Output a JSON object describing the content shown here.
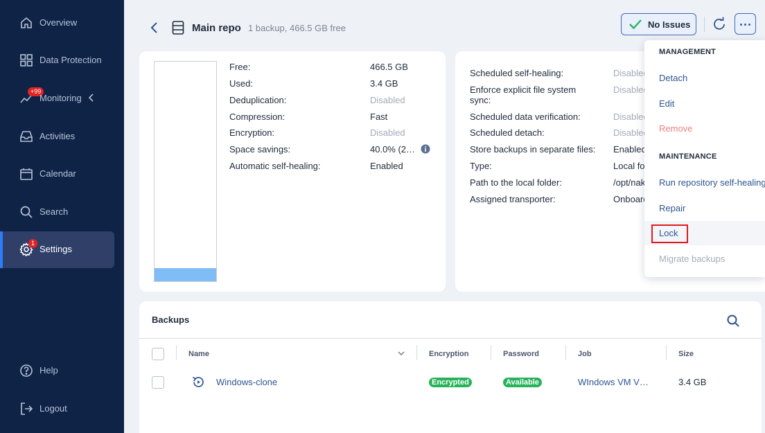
{
  "sidebar": {
    "items": [
      {
        "label": "Overview",
        "icon": "home-icon"
      },
      {
        "label": "Data Protection",
        "icon": "grid-icon"
      },
      {
        "label": "Monitoring",
        "icon": "chart-icon",
        "badge": "+99"
      },
      {
        "label": "Activities",
        "icon": "inbox-icon"
      },
      {
        "label": "Calendar",
        "icon": "calendar-icon"
      },
      {
        "label": "Search",
        "icon": "search-icon"
      },
      {
        "label": "Settings",
        "icon": "gear-icon",
        "badge": "1",
        "active": true
      }
    ],
    "bottom": [
      {
        "label": "Help",
        "icon": "help-icon"
      },
      {
        "label": "Logout",
        "icon": "logout-icon"
      }
    ]
  },
  "header": {
    "title": "Main repo",
    "subtitle": "1 backup, 466.5 GB free",
    "status_label": "No Issues"
  },
  "usage": {
    "used_fraction": 0.0073
  },
  "details_left": [
    {
      "label": "Free:",
      "value": "466.5 GB"
    },
    {
      "label": "Used:",
      "value": "3.4 GB"
    },
    {
      "label": "Deduplication:",
      "value": "Disabled",
      "muted": true
    },
    {
      "label": "Compression:",
      "value": "Fast"
    },
    {
      "label": "Encryption:",
      "value": "Disabled",
      "muted": true
    },
    {
      "label": "Space savings:",
      "value": "40.0% (2…"
    },
    {
      "label": "Automatic self-healing:",
      "value": "Enabled"
    }
  ],
  "details_right": [
    {
      "label": "Scheduled self-healing:",
      "value": "Disabled",
      "muted": true
    },
    {
      "label": "Enforce explicit file system",
      "label2": "sync:",
      "value": "Disabled",
      "muted": true
    },
    {
      "label": "Scheduled data verification:",
      "value": "Disabled",
      "muted": true
    },
    {
      "label": "Scheduled detach:",
      "value": "Disabled",
      "muted": true
    },
    {
      "label": "Store backups in separate files:",
      "value": "Enabled"
    },
    {
      "label": "Type:",
      "value": "Local fo"
    },
    {
      "label": "Path to the local folder:",
      "value": "/opt/nak"
    },
    {
      "label": "Assigned transporter:",
      "value": "Onboard"
    }
  ],
  "backups": {
    "title": "Backups",
    "columns": [
      "Name",
      "Encryption",
      "Password",
      "Job",
      "Size"
    ],
    "rows": [
      {
        "name": "Windows-clone",
        "encryption": "Encrypted",
        "password": "Available",
        "job": "WIndows VM V…",
        "size": "3.4 GB"
      }
    ]
  },
  "menu": {
    "management_label": "MANAGEMENT",
    "maintenance_label": "MAINTENANCE",
    "detach": "Detach",
    "edit": "Edit",
    "remove": "Remove",
    "self_healing": "Run repository self-healing",
    "repair": "Repair",
    "lock": "Lock",
    "migrate": "Migrate backups"
  },
  "colors": {
    "sidebar_bg": "#0f2347",
    "accent": "#2f7bf5",
    "success": "#27b35a",
    "danger": "#e0191f"
  }
}
